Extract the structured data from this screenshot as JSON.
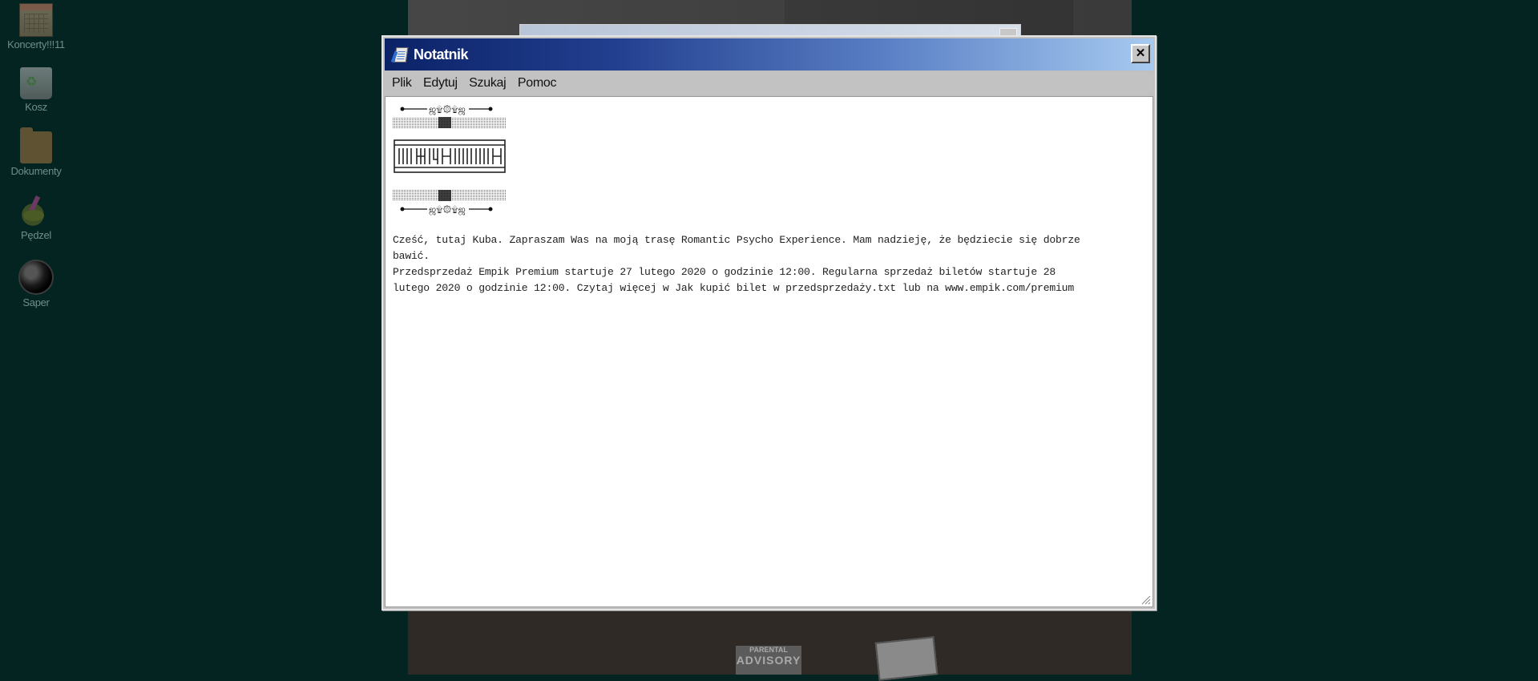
{
  "desktop": {
    "icons": [
      {
        "label": "Koncerty!!!11",
        "icon": "calendar-icon"
      },
      {
        "label": "Kosz",
        "icon": "recycle-bin-icon"
      },
      {
        "label": "Dokumenty",
        "icon": "folder-icon"
      },
      {
        "label": "Pędzel",
        "icon": "paint-icon"
      },
      {
        "label": "Saper",
        "icon": "minesweeper-icon"
      }
    ]
  },
  "background": {
    "advisory_top": "PARENTAL",
    "advisory_main": "ADVISORY"
  },
  "notepad": {
    "title": "Notatnik",
    "close_label": "✕",
    "menu": [
      "Plik",
      "Edytuj",
      "Szukaj",
      "Pomoc"
    ],
    "ornament": "•——ஜ۩۞۩ஜ——•",
    "body": "Cześć, tutaj Kuba. Zapraszam Was na moją trasę Romantic Psycho Experience. Mam nadzieję, że będziecie się dobrze\nbawić.\nPrzedsprzedaż Empik Premium startuje 27 lutego 2020 o godzinie 12:00. Regularna sprzedaż biletów startuje 28\nlutego 2020 o godzinie 12:00. Czytaj więcej w Jak kupić bilet w przedsprzedaży.txt lub na www.empik.com/premium"
  },
  "colors": {
    "desktop": "#032420",
    "title_start": "#0b2267",
    "title_end": "#a6caf0"
  }
}
